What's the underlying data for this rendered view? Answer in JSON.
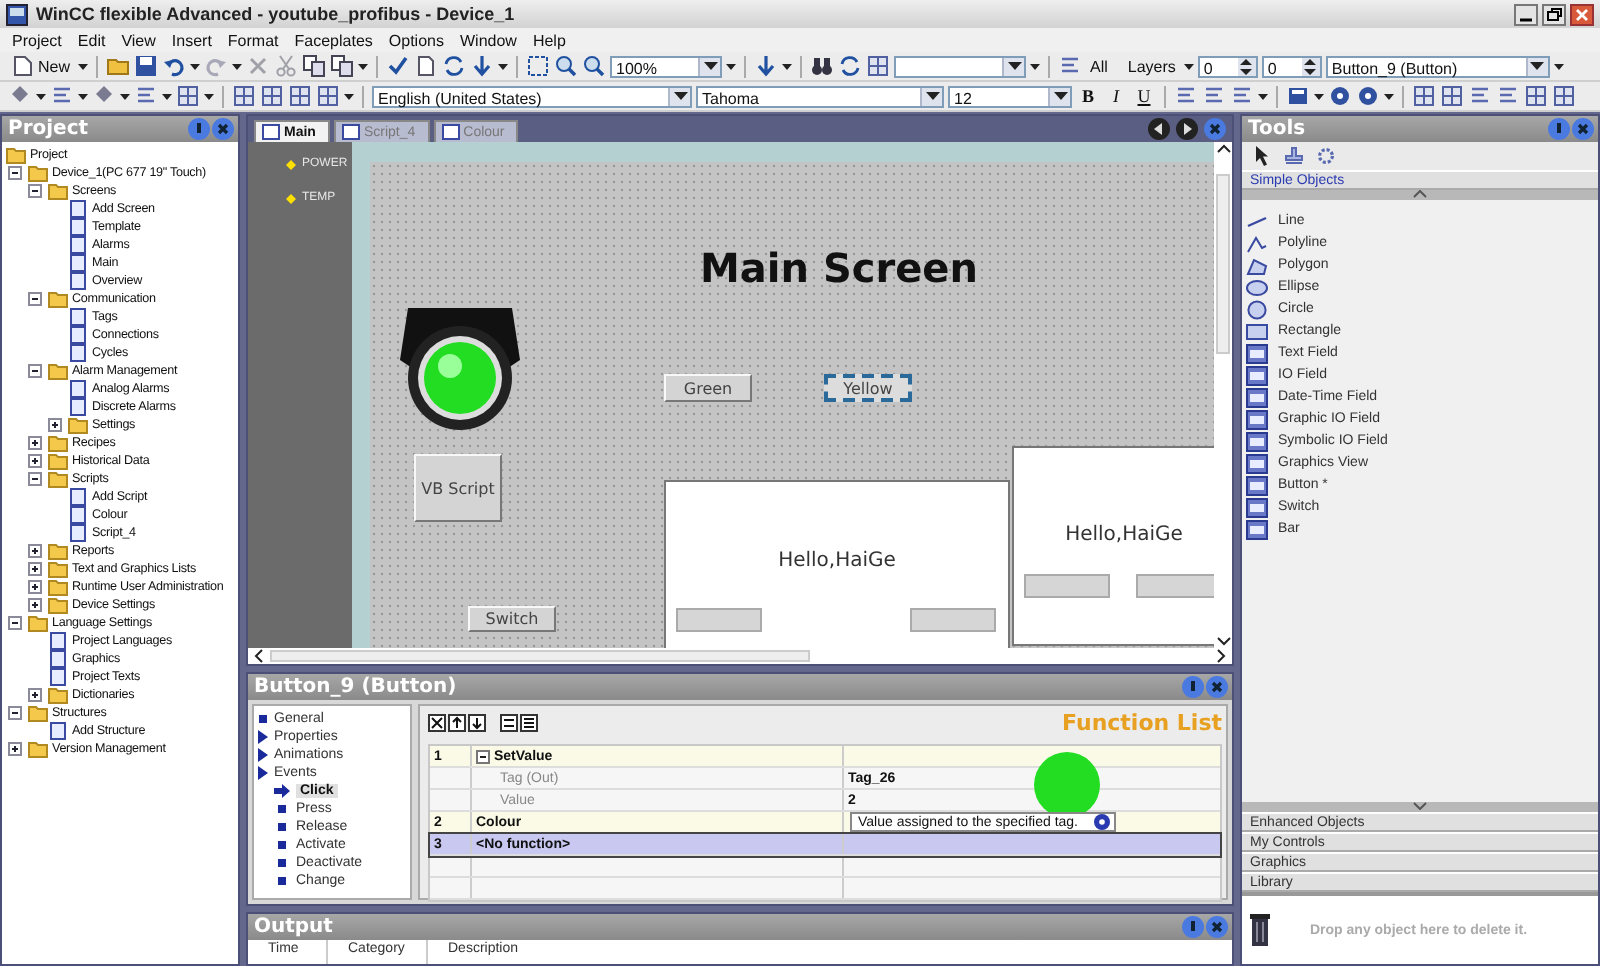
{
  "window": {
    "title": "WinCC flexible Advanced - youtube_profibus - Device_1"
  },
  "menu": [
    "Project",
    "Edit",
    "View",
    "Insert",
    "Format",
    "Faceplates",
    "Options",
    "Window",
    "Help"
  ],
  "toolbar": {
    "new_label": "New",
    "zoom": "100%",
    "all_label": "All",
    "layers_label": "Layers",
    "layer_from": "0",
    "layer_to": "0",
    "object": "Button_9 (Button)",
    "language": "English (United States)",
    "font": "Tahoma",
    "font_size": "12",
    "bold": "B",
    "italic": "I",
    "underline": "U"
  },
  "project": {
    "title": "Project",
    "tree": [
      {
        "label": "Project",
        "children": [
          {
            "label": "Device_1(PC 677 19\" Touch)",
            "expanded": true,
            "children": [
              {
                "label": "Screens",
                "expanded": true,
                "children": [
                  {
                    "label": "Add Screen"
                  },
                  {
                    "label": "Template"
                  },
                  {
                    "label": "Alarms"
                  },
                  {
                    "label": "Main"
                  },
                  {
                    "label": "Overview"
                  }
                ]
              },
              {
                "label": "Communication",
                "expanded": true,
                "children": [
                  {
                    "label": "Tags"
                  },
                  {
                    "label": "Connections"
                  },
                  {
                    "label": "Cycles"
                  }
                ]
              },
              {
                "label": "Alarm Management",
                "expanded": true,
                "children": [
                  {
                    "label": "Analog Alarms"
                  },
                  {
                    "label": "Discrete Alarms"
                  },
                  {
                    "label": "Settings",
                    "expanded": false
                  }
                ]
              },
              {
                "label": "Recipes",
                "expanded": false
              },
              {
                "label": "Historical Data",
                "expanded": false
              },
              {
                "label": "Scripts",
                "expanded": true,
                "children": [
                  {
                    "label": "Add Script"
                  },
                  {
                    "label": "Colour"
                  },
                  {
                    "label": "Script_4"
                  }
                ]
              },
              {
                "label": "Reports",
                "expanded": false
              },
              {
                "label": "Text and Graphics Lists",
                "expanded": false
              },
              {
                "label": "Runtime User Administration",
                "expanded": false
              },
              {
                "label": "Device Settings",
                "expanded": false
              }
            ]
          },
          {
            "label": "Language Settings",
            "expanded": true,
            "children": [
              {
                "label": "Project Languages"
              },
              {
                "label": "Graphics"
              },
              {
                "label": "Project Texts"
              },
              {
                "label": "Dictionaries",
                "expanded": false
              }
            ]
          },
          {
            "label": "Structures",
            "expanded": true,
            "children": [
              {
                "label": "Add Structure"
              }
            ]
          },
          {
            "label": "Version Management",
            "expanded": false
          }
        ]
      }
    ]
  },
  "editor": {
    "tabs": [
      {
        "label": "Main",
        "selected": true
      },
      {
        "label": "Script_4",
        "selected": false
      },
      {
        "label": "Colour",
        "selected": false
      }
    ],
    "indicators": [
      "POWER",
      "TEMP"
    ],
    "screen": {
      "title": "Main Screen",
      "lamp": {
        "lit": true
      },
      "buttons": [
        {
          "label": "Green",
          "selected": false
        },
        {
          "label": "Yellow",
          "selected": true
        },
        {
          "label": "VB Script",
          "selected": false
        },
        {
          "label": "Switch",
          "selected": false
        }
      ],
      "windows": [
        {
          "text": "Hello,HaiGe"
        },
        {
          "text": "Hello,HaiGe"
        }
      ]
    }
  },
  "properties": {
    "title": "Button_9 (Button)",
    "nav": [
      {
        "label": "General",
        "kind": "page"
      },
      {
        "label": "Properties",
        "kind": "group"
      },
      {
        "label": "Animations",
        "kind": "group"
      },
      {
        "label": "Events",
        "kind": "group",
        "children": [
          {
            "label": "Click",
            "selected": true
          },
          {
            "label": "Press",
            "selected": false
          },
          {
            "label": "Release",
            "selected": false
          },
          {
            "label": "Activate",
            "selected": false
          },
          {
            "label": "Deactivate",
            "selected": false
          },
          {
            "label": "Change",
            "selected": false
          }
        ]
      }
    ],
    "function_list": {
      "title": "Function List",
      "rows": [
        {
          "kind": "function",
          "number": "1",
          "name": "SetValue",
          "expanded": true,
          "selected": false
        },
        {
          "kind": "parameter",
          "name": "Tag (Out)",
          "value": "Tag_26",
          "selected": false
        },
        {
          "kind": "parameter",
          "name": "Value",
          "value": "2",
          "selected": false
        },
        {
          "kind": "function",
          "number": "2",
          "name": "Colour",
          "selected": false
        },
        {
          "kind": "function",
          "number": "3",
          "name": "<No function>",
          "selected": true
        }
      ],
      "tooltip": "Value assigned to the specified tag."
    }
  },
  "output": {
    "title": "Output",
    "columns": [
      "Time",
      "Category",
      "Description"
    ]
  },
  "tools": {
    "title": "Tools",
    "sections": [
      {
        "label": "Simple Objects",
        "expanded": true,
        "items": [
          {
            "label": "Line"
          },
          {
            "label": "Polyline"
          },
          {
            "label": "Polygon"
          },
          {
            "label": "Ellipse"
          },
          {
            "label": "Circle"
          },
          {
            "label": "Rectangle"
          },
          {
            "label": "Text Field"
          },
          {
            "label": "IO Field"
          },
          {
            "label": "Date-Time Field"
          },
          {
            "label": "Graphic IO Field"
          },
          {
            "label": "Symbolic IO Field"
          },
          {
            "label": "Graphics View"
          },
          {
            "label": "Button *"
          },
          {
            "label": "Switch"
          },
          {
            "label": "Bar"
          }
        ]
      },
      {
        "label": "Enhanced Objects",
        "expanded": false
      },
      {
        "label": "My Controls",
        "expanded": false
      },
      {
        "label": "Graphics",
        "expanded": false
      },
      {
        "label": "Library",
        "expanded": false
      }
    ],
    "drop_hint": "Drop any object here to delete it."
  }
}
